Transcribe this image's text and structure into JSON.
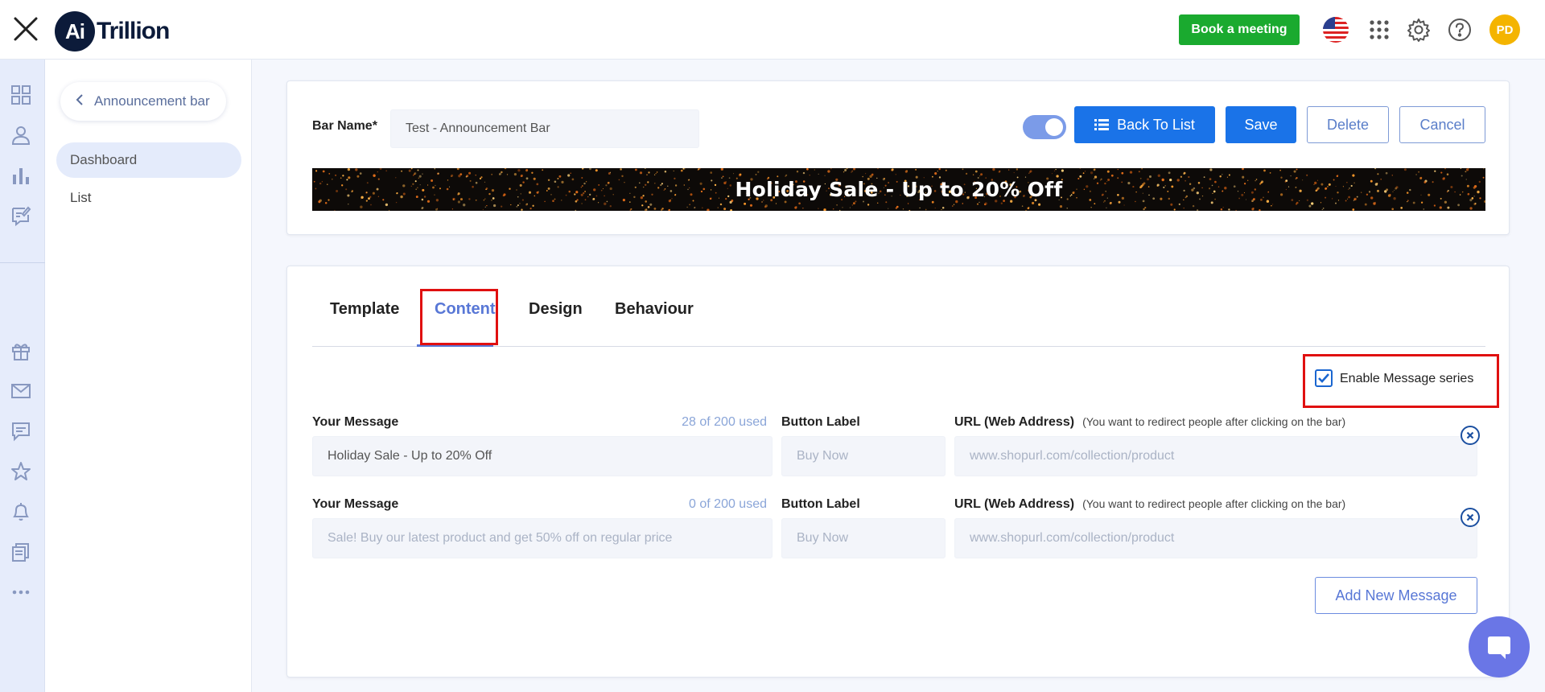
{
  "header": {
    "logo_mark": "Ai",
    "logo_text": "Trillion",
    "book_meeting_label": "Book a meeting",
    "avatar_initials": "PD"
  },
  "sidebar": {
    "back_label": "Announcement bar",
    "items": [
      {
        "label": "Dashboard",
        "active": true
      },
      {
        "label": "List",
        "active": false
      }
    ]
  },
  "editor": {
    "bar_name_label": "Bar Name*",
    "bar_name_value": "Test - Announcement Bar",
    "toggle_enabled": true,
    "back_to_list_label": "Back To List",
    "save_label": "Save",
    "delete_label": "Delete",
    "cancel_label": "Cancel",
    "banner_text": "Holiday Sale - Up to 20% Off"
  },
  "tabs": [
    {
      "label": "Template",
      "active": false
    },
    {
      "label": "Content",
      "active": true
    },
    {
      "label": "Design",
      "active": false
    },
    {
      "label": "Behaviour",
      "active": false
    }
  ],
  "content": {
    "enable_series_label": "Enable Message series",
    "enable_series_checked": true,
    "message_label": "Your Message",
    "button_label_label": "Button Label",
    "url_label": "URL (Web Address)",
    "url_hint": "(You want to redirect people after clicking on the bar)",
    "messages": [
      {
        "used": "28 of 200 used",
        "message_value": "Holiday Sale - Up to 20% Off",
        "message_placeholder": "",
        "button_placeholder": "Buy Now",
        "url_placeholder": "www.shopurl.com/collection/product"
      },
      {
        "used": "0 of 200 used",
        "message_value": "",
        "message_placeholder": "Sale! Buy our latest product and get 50% off on regular price",
        "button_placeholder": "Buy Now",
        "url_placeholder": "www.shopurl.com/collection/product"
      }
    ],
    "add_message_label": "Add New Message"
  },
  "colors": {
    "primary": "#1a73e8",
    "book_green": "#1aaa2f",
    "accent": "#5877d6",
    "highlight_red": "#e01010"
  }
}
